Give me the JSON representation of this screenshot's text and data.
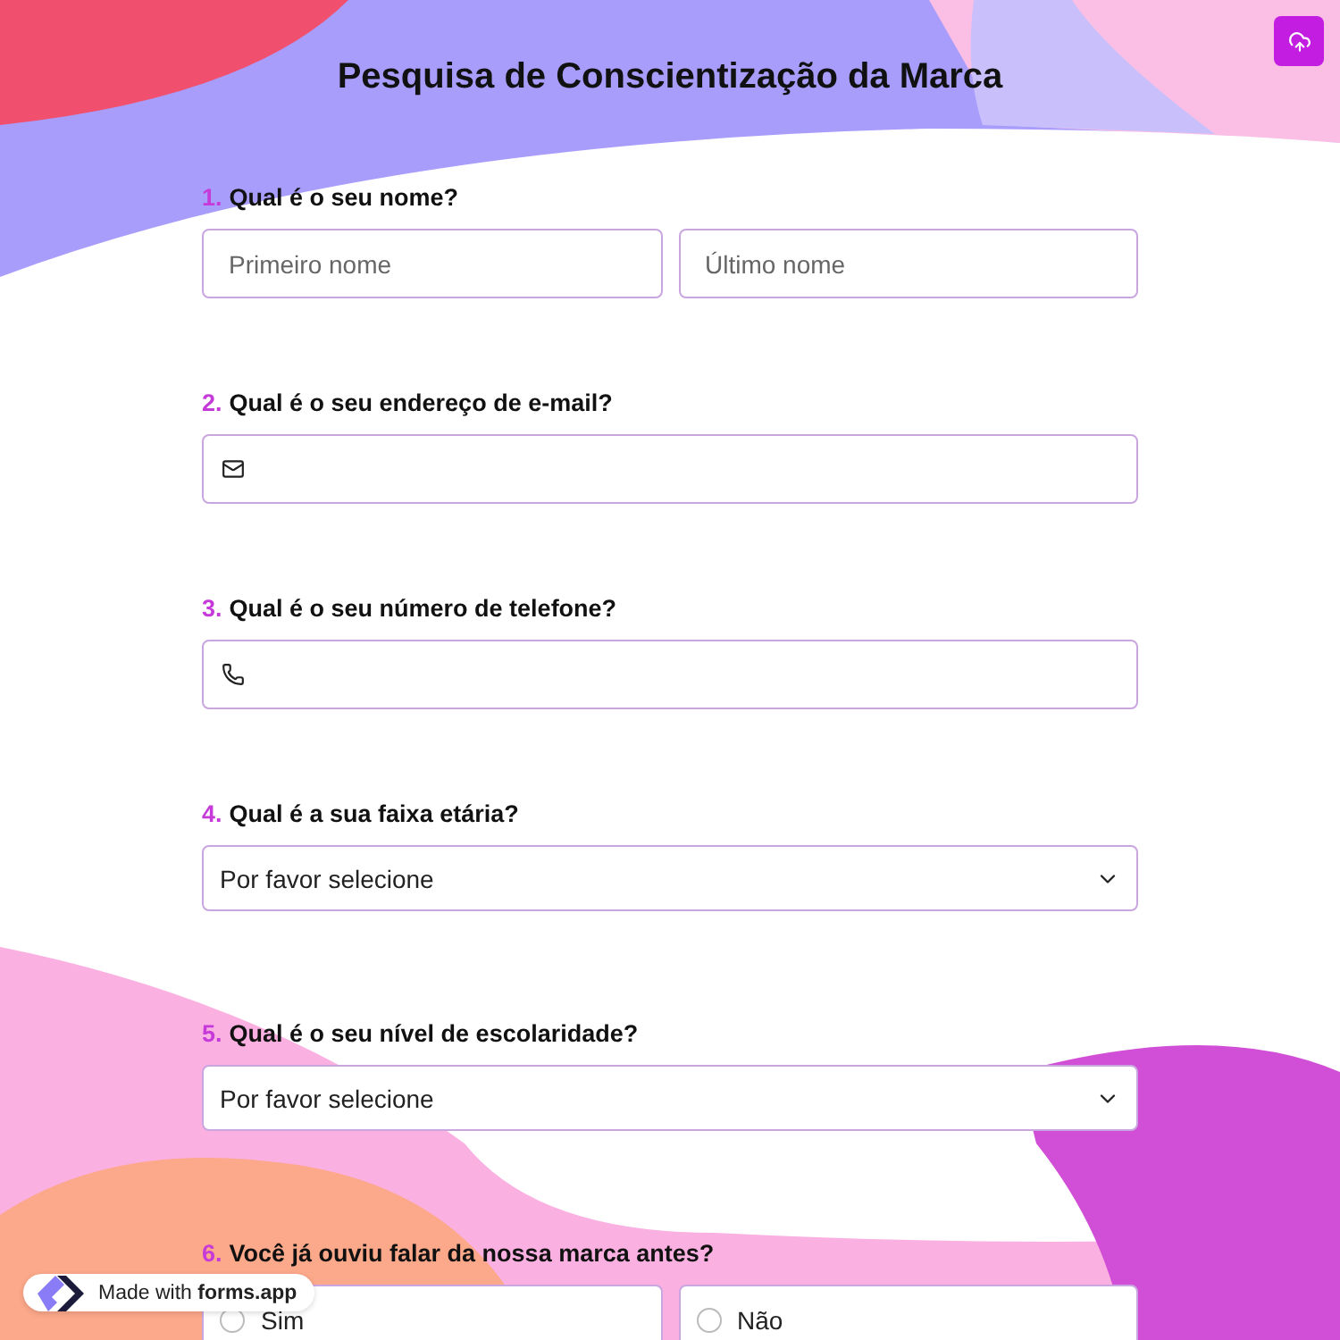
{
  "title": "Pesquisa de Conscientização da Marca",
  "questions": [
    {
      "number": "1.",
      "label": "Qual é o seu nome?",
      "kind": "name",
      "fields": [
        {
          "placeholder": "Primeiro nome"
        },
        {
          "placeholder": "Último nome"
        }
      ]
    },
    {
      "number": "2.",
      "label": "Qual é o seu endereço de e-mail?",
      "kind": "email"
    },
    {
      "number": "3.",
      "label": "Qual é o seu número de telefone?",
      "kind": "phone"
    },
    {
      "number": "4.",
      "label": "Qual é a sua faixa etária?",
      "kind": "select",
      "placeholder": "Por favor selecione"
    },
    {
      "number": "5.",
      "label": "Qual é o seu nível de escolaridade?",
      "kind": "select",
      "placeholder": "Por favor selecione"
    },
    {
      "number": "6.",
      "label": "Você já ouviu falar da nossa marca antes?",
      "kind": "radio",
      "options": [
        {
          "label": "Sim",
          "selected": false
        },
        {
          "label": "Não",
          "selected": false
        }
      ]
    }
  ],
  "badge": "Made with **forms.app**"
}
